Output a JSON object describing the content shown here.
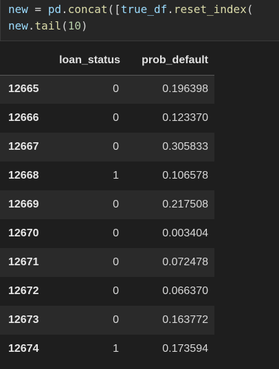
{
  "code": {
    "line1": {
      "var": "new",
      "eq": " = ",
      "mod": "pd",
      "dot1": ".",
      "fn1": "concat",
      "p1": "([",
      "arg": "true_df",
      "dot2": ".",
      "fn2": "reset_index",
      "p2": "("
    },
    "line2": {
      "var": "new",
      "dot": ".",
      "fn": "tail",
      "p_open": "(",
      "num": "10",
      "p_close": ")"
    }
  },
  "table": {
    "columns": [
      "",
      "loan_status",
      "prob_default"
    ],
    "rows": [
      {
        "index": "12665",
        "loan_status": "0",
        "prob_default": "0.196398"
      },
      {
        "index": "12666",
        "loan_status": "0",
        "prob_default": "0.123370"
      },
      {
        "index": "12667",
        "loan_status": "0",
        "prob_default": "0.305833"
      },
      {
        "index": "12668",
        "loan_status": "1",
        "prob_default": "0.106578"
      },
      {
        "index": "12669",
        "loan_status": "0",
        "prob_default": "0.217508"
      },
      {
        "index": "12670",
        "loan_status": "0",
        "prob_default": "0.003404"
      },
      {
        "index": "12671",
        "loan_status": "0",
        "prob_default": "0.072478"
      },
      {
        "index": "12672",
        "loan_status": "0",
        "prob_default": "0.066370"
      },
      {
        "index": "12673",
        "loan_status": "0",
        "prob_default": "0.163772"
      },
      {
        "index": "12674",
        "loan_status": "1",
        "prob_default": "0.173594"
      }
    ]
  },
  "colors": {
    "background": "#1e1e1e",
    "code_cell_bg": "#262626",
    "variable": "#9cdcfe",
    "function": "#dcdcaa",
    "number": "#b5cea8",
    "striped_row": "#2a2a2a"
  }
}
